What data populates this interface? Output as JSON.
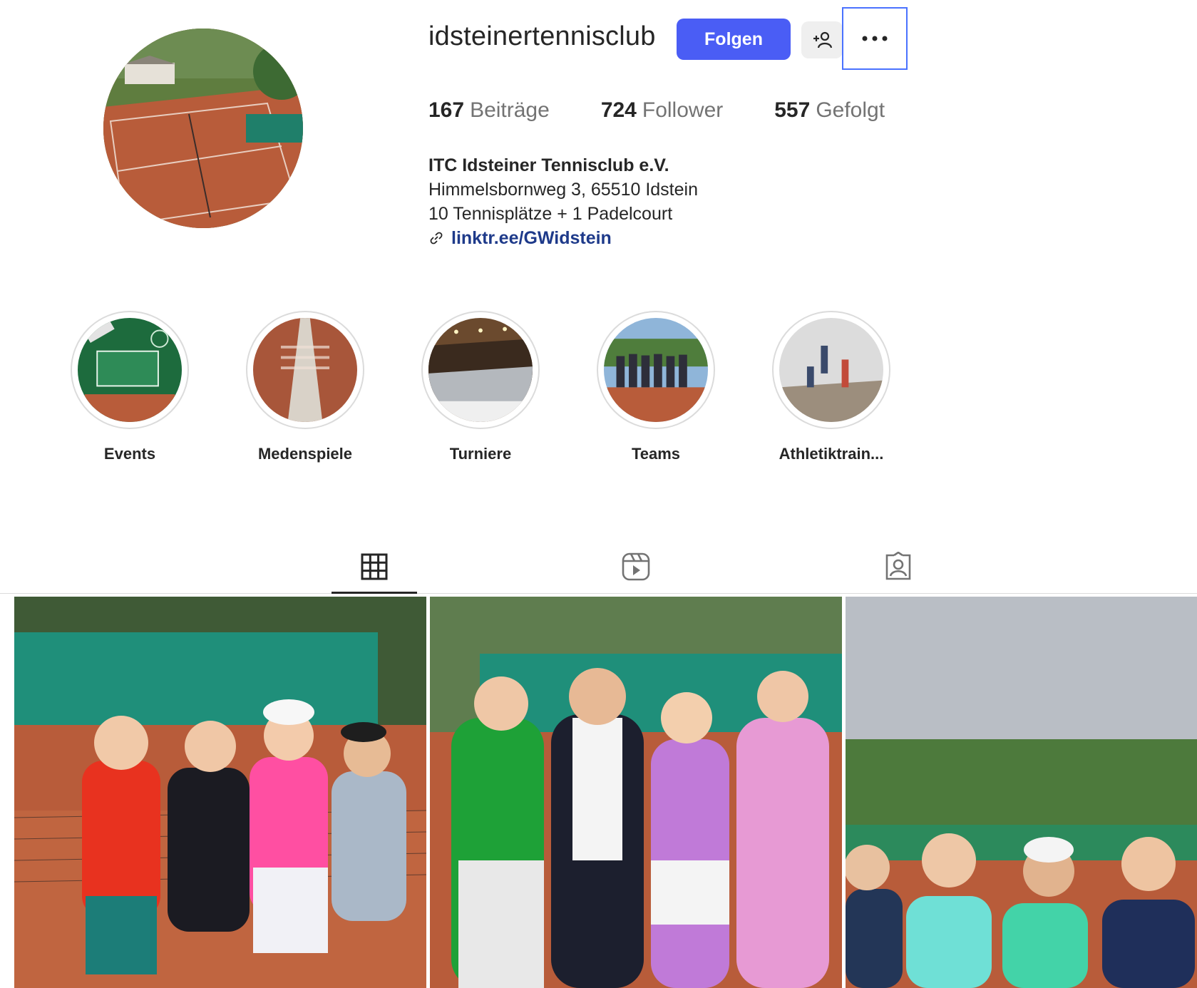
{
  "profile": {
    "username": "idsteinertennisclub",
    "follow_label": "Folgen",
    "stats": [
      {
        "count": "167",
        "label": "Beiträge"
      },
      {
        "count": "724",
        "label": "Follower"
      },
      {
        "count": "557",
        "label": "Gefolgt"
      }
    ],
    "bio": {
      "name": "ITC Idsteiner Tennisclub e.V.",
      "address": "Himmelsbornweg 3, 65510 Idstein",
      "courts": "10 Tennisplätze + 1 Padelcourt",
      "link": "linktr.ee/GWidstein"
    }
  },
  "highlights": [
    {
      "label": "Events"
    },
    {
      "label": "Medenspiele"
    },
    {
      "label": "Turniere"
    },
    {
      "label": "Teams"
    },
    {
      "label": "Athletiktrain..."
    }
  ],
  "tabs": [
    {
      "icon": "grid-icon",
      "active": true
    },
    {
      "icon": "reels-icon",
      "active": false
    },
    {
      "icon": "tagged-icon",
      "active": false
    }
  ],
  "colors": {
    "accent": "#4a5df5",
    "link": "#1e3a8a",
    "court_clay": "#b85c3a",
    "windscreen_green": "#1f8f7a"
  }
}
